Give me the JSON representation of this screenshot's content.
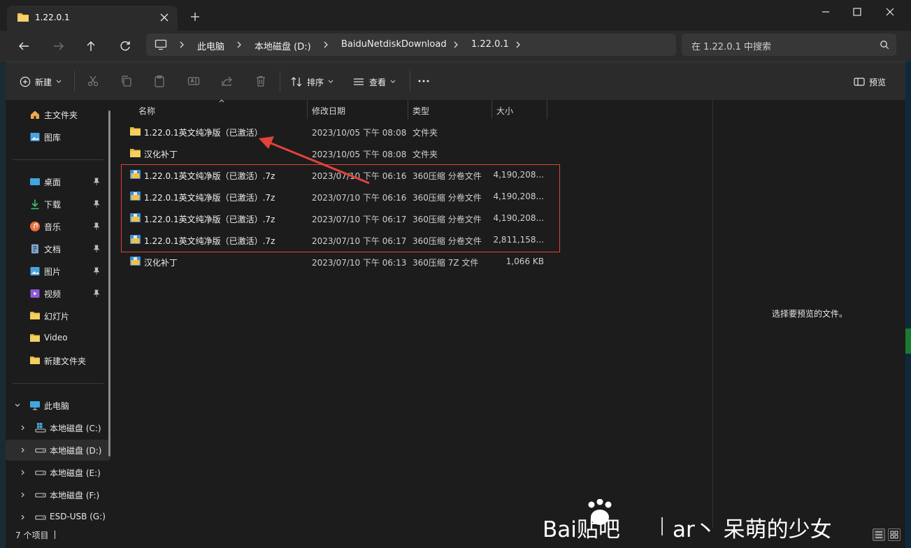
{
  "window": {
    "tab_title": "1.22.0.1"
  },
  "address_bar": {
    "crumbs": [
      "此电脑",
      "本地磁盘 (D:)",
      "BaiduNetdiskDownload",
      "1.22.0.1"
    ],
    "search_placeholder": "在 1.22.0.1 中搜索"
  },
  "toolbar": {
    "new_label": "新建",
    "sort_label": "排序",
    "view_label": "查看",
    "preview_label": "预览"
  },
  "sidebar": {
    "quick": [
      {
        "label": "主文件夹",
        "icon": "home-icon"
      },
      {
        "label": "图库",
        "icon": "gallery-icon"
      }
    ],
    "pinned": [
      {
        "label": "桌面",
        "icon": "desktop-icon"
      },
      {
        "label": "下载",
        "icon": "download-icon"
      },
      {
        "label": "音乐",
        "icon": "music-icon"
      },
      {
        "label": "文档",
        "icon": "document-icon"
      },
      {
        "label": "图片",
        "icon": "picture-icon"
      },
      {
        "label": "视频",
        "icon": "video-icon"
      },
      {
        "label": "幻灯片",
        "icon": "folder-icon"
      },
      {
        "label": "Video",
        "icon": "folder-icon"
      },
      {
        "label": "新建文件夹",
        "icon": "folder-icon"
      }
    ],
    "this_pc": "此电脑",
    "drives": [
      {
        "label": "本地磁盘 (C:)",
        "icon": "system-drive-icon"
      },
      {
        "label": "本地磁盘 (D:)",
        "icon": "drive-icon"
      },
      {
        "label": "本地磁盘 (E:)",
        "icon": "drive-icon"
      },
      {
        "label": "本地磁盘 (F:)",
        "icon": "drive-icon"
      },
      {
        "label": "ESD-USB (G:)",
        "icon": "drive-icon"
      }
    ]
  },
  "columns": {
    "name": "名称",
    "date": "修改日期",
    "type": "类型",
    "size": "大小"
  },
  "files": [
    {
      "name": "1.22.0.1英文纯净版（已激活）",
      "date": "2023/10/05 下午 08:08",
      "type": "文件夹",
      "size": "",
      "icon": "folder-icon"
    },
    {
      "name": "汉化补丁",
      "date": "2023/10/05 下午 08:08",
      "type": "文件夹",
      "size": "",
      "icon": "folder-icon"
    },
    {
      "name": "1.22.0.1英文纯净版（已激活）.7z",
      "date": "2023/07/10 下午 06:16",
      "type": "360压缩 分卷文件",
      "size": "4,190,208...",
      "icon": "archive-icon"
    },
    {
      "name": "1.22.0.1英文纯净版（已激活）.7z",
      "date": "2023/07/10 下午 06:16",
      "type": "360压缩 分卷文件",
      "size": "4,190,208...",
      "icon": "archive-icon"
    },
    {
      "name": "1.22.0.1英文纯净版（已激活）.7z",
      "date": "2023/07/10 下午 06:17",
      "type": "360压缩 分卷文件",
      "size": "4,190,208...",
      "icon": "archive-icon"
    },
    {
      "name": "1.22.0.1英文纯净版（已激活）.7z",
      "date": "2023/07/10 下午 06:17",
      "type": "360压缩 分卷文件",
      "size": "2,811,158...",
      "icon": "archive-icon"
    },
    {
      "name": "汉化补丁",
      "date": "2023/07/10 下午 06:13",
      "type": "360压缩 7Z 文件",
      "size": "1,066 KB",
      "icon": "archive-icon"
    }
  ],
  "preview_pane": {
    "message": "选择要预览的文件。"
  },
  "status": {
    "item_count": "7 个项目"
  },
  "watermark": {
    "brand": "Bai贴吧",
    "author": "ar丶 呆萌的少女"
  },
  "colors": {
    "annotation_red": "#e0433a",
    "folder_yellow": "#f2c04a",
    "background": "#1c1c1c"
  }
}
